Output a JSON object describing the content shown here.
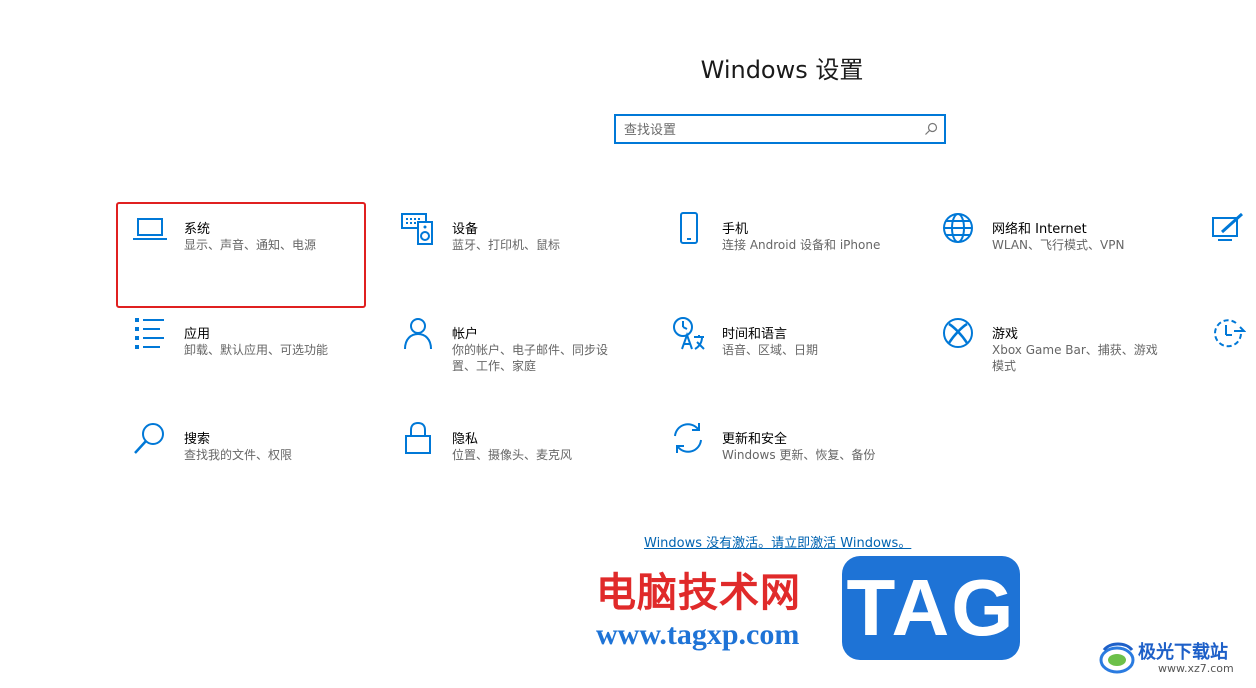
{
  "window": {
    "title": "Windows 设置"
  },
  "search": {
    "placeholder": "查找设置",
    "value": ""
  },
  "accent_color": "#0078d7",
  "highlight_color": "#e02020",
  "tiles": [
    {
      "name": "系统",
      "desc": "显示、声音、通知、电源",
      "icon": "laptop-icon"
    },
    {
      "name": "设备",
      "desc": "蓝牙、打印机、鼠标",
      "icon": "keyboard-speaker-icon"
    },
    {
      "name": "手机",
      "desc": "连接 Android 设备和 iPhone",
      "icon": "phone-icon"
    },
    {
      "name": "网络和 Internet",
      "desc": "WLAN、飞行模式、VPN",
      "icon": "globe-icon"
    },
    {
      "name": "应用",
      "desc": "卸载、默认应用、可选功能",
      "icon": "apps-list-icon"
    },
    {
      "name": "帐户",
      "desc": "你的帐户、电子邮件、同步设置、工作、家庭",
      "icon": "person-icon"
    },
    {
      "name": "时间和语言",
      "desc": "语音、区域、日期",
      "icon": "time-language-icon"
    },
    {
      "name": "游戏",
      "desc": "Xbox Game Bar、捕获、游戏模式",
      "icon": "xbox-icon"
    },
    {
      "name": "搜索",
      "desc": "查找我的文件、权限",
      "icon": "search-icon"
    },
    {
      "name": "隐私",
      "desc": "位置、摄像头、麦克风",
      "icon": "lock-icon"
    },
    {
      "name": "更新和安全",
      "desc": "Windows 更新、恢复、备份",
      "icon": "sync-icon"
    }
  ],
  "activation": {
    "text": "Windows 没有激活。请立即激活 Windows。"
  },
  "watermark": {
    "cn": "电脑技术网",
    "url": "www.tagxp.com",
    "tag": "TAG",
    "site_cn": "极光下载站",
    "site_url": "www.xz7.com"
  }
}
